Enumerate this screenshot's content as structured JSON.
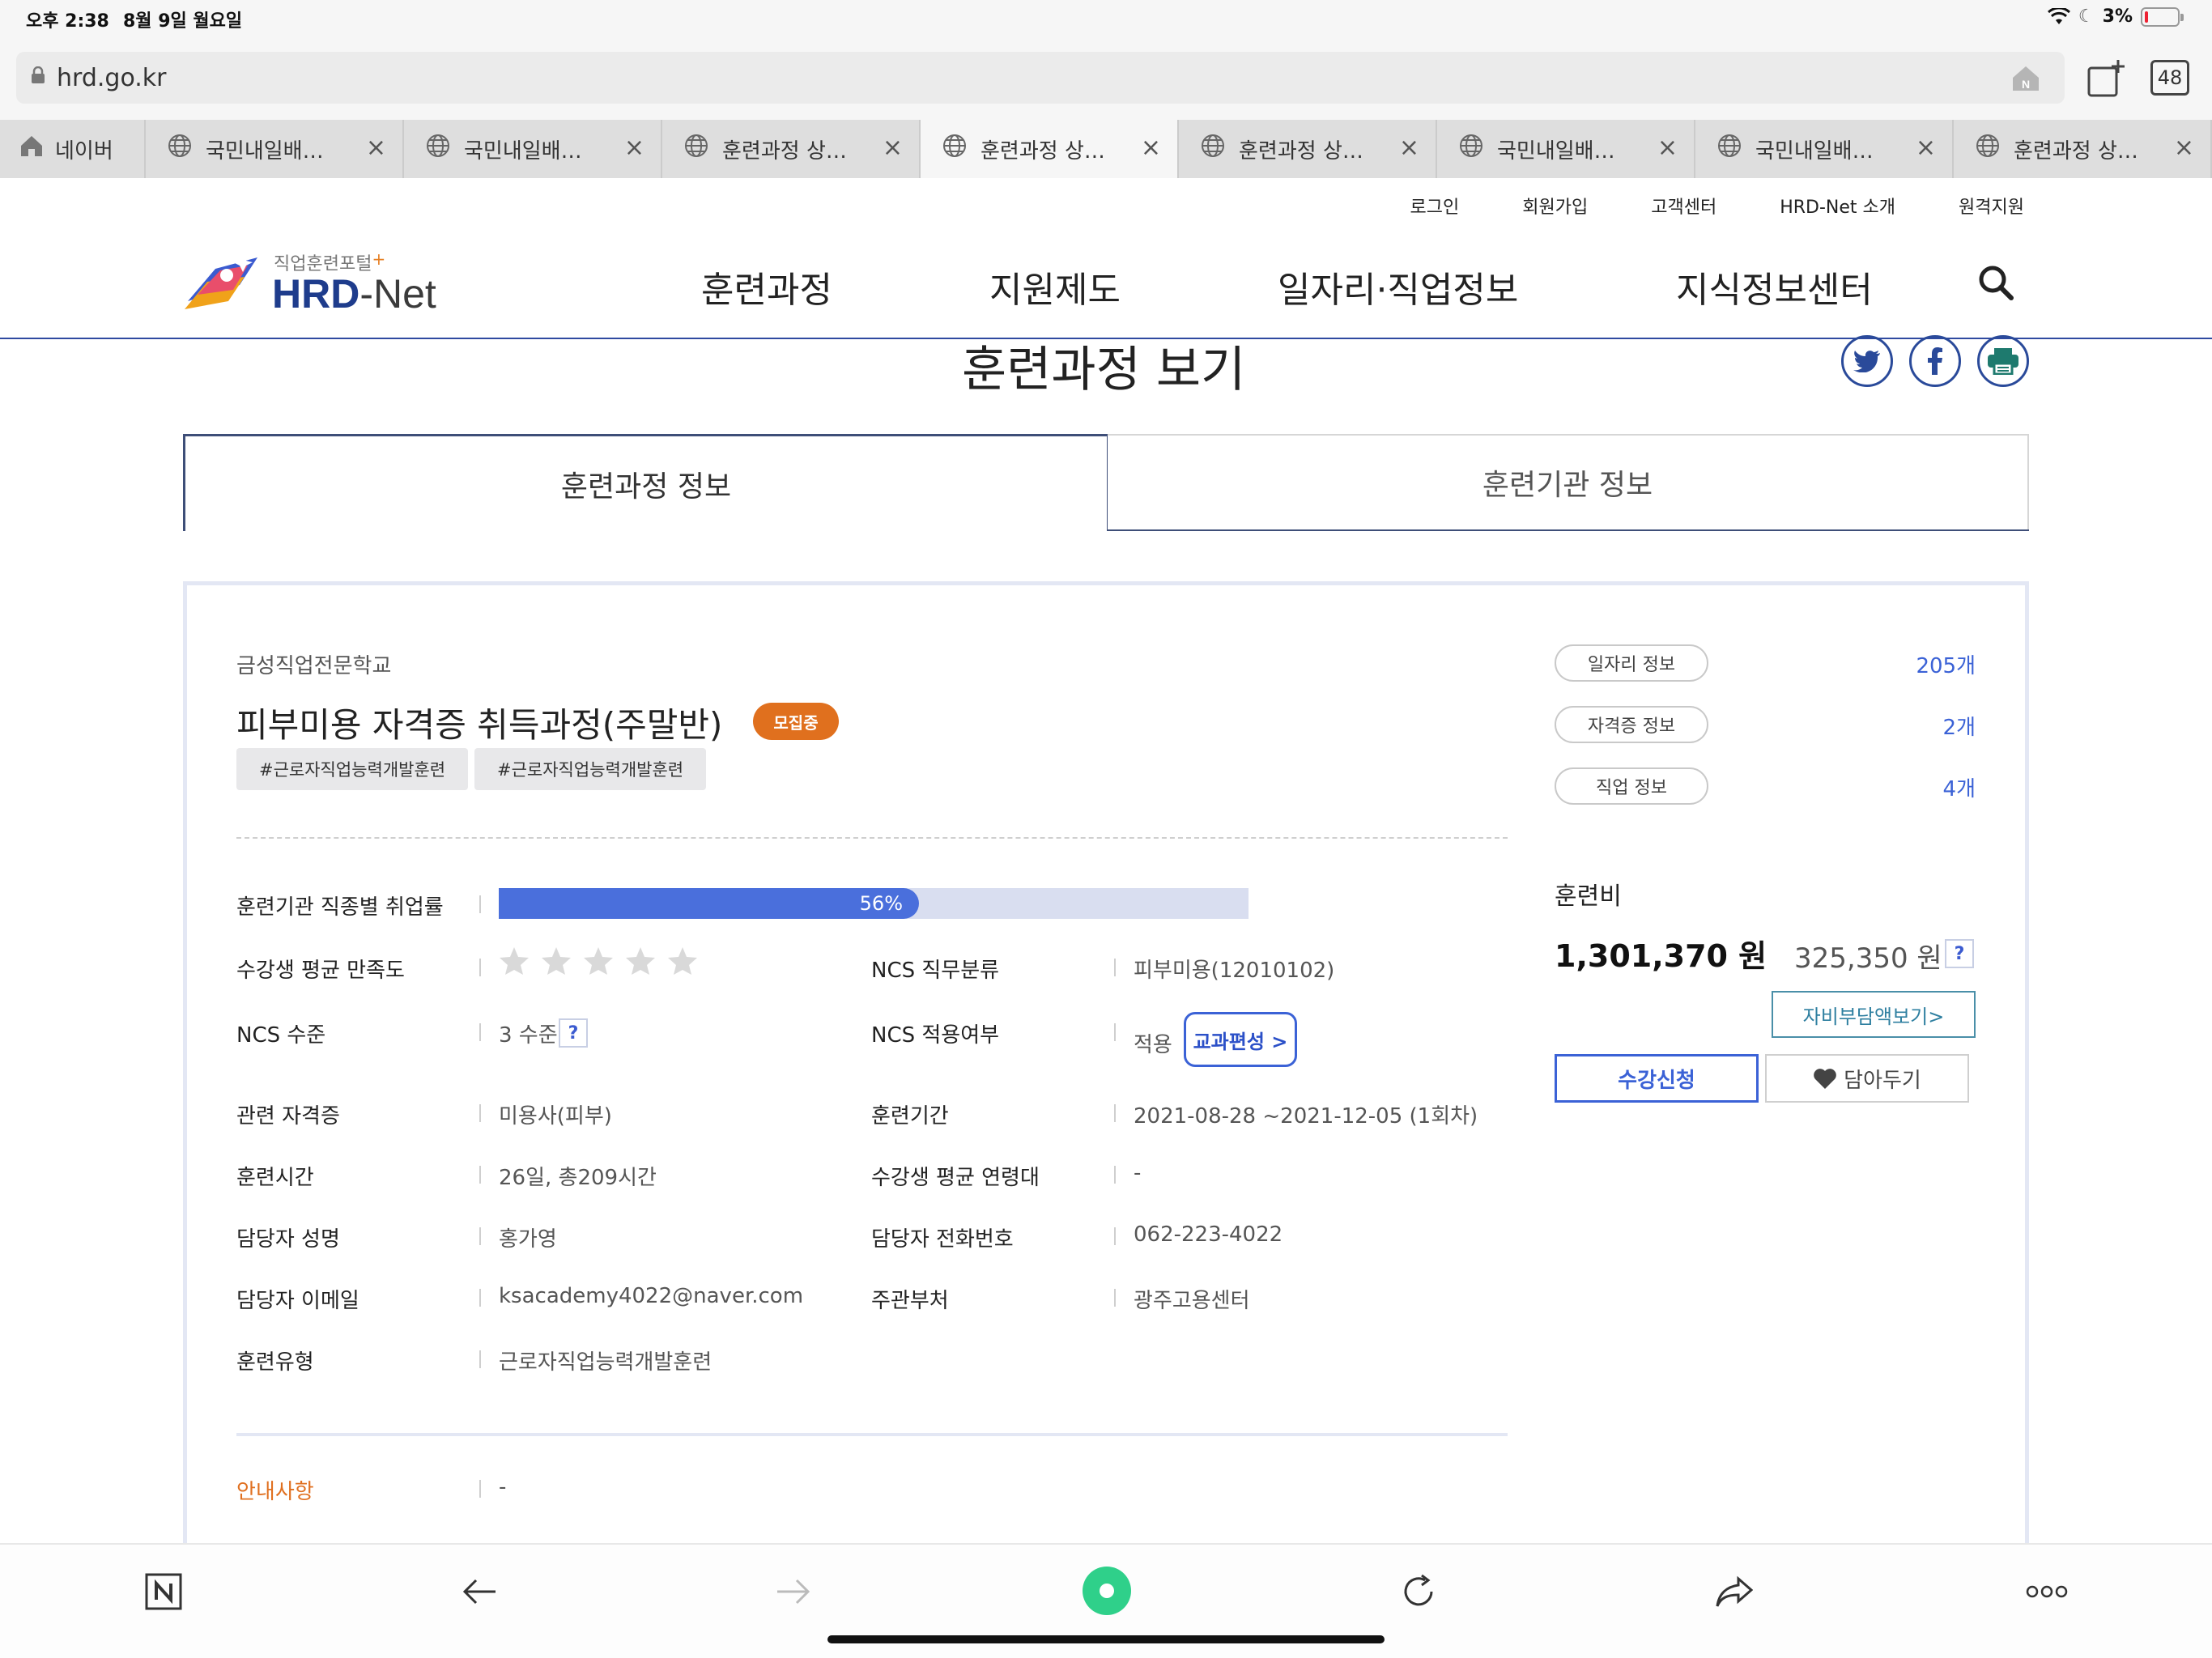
{
  "status_bar": {
    "time": "오후 2:38",
    "date": "8월 9일 월요일",
    "battery": "3%"
  },
  "browser": {
    "url": "hrd.go.kr",
    "tab_count": "48",
    "tabs": [
      {
        "label": "네이버",
        "icon": "home-icon"
      },
      {
        "label": "국민내일배…",
        "icon": "globe-icon"
      },
      {
        "label": "국민내일배…",
        "icon": "globe-icon"
      },
      {
        "label": "훈련과정 상…",
        "icon": "globe-icon"
      },
      {
        "label": "훈련과정 상…",
        "icon": "globe-icon"
      },
      {
        "label": "훈련과정 상…",
        "icon": "globe-icon"
      },
      {
        "label": "국민내일배…",
        "icon": "globe-icon"
      },
      {
        "label": "국민내일배…",
        "icon": "globe-icon"
      },
      {
        "label": "훈련과정 상…",
        "icon": "globe-icon"
      }
    ]
  },
  "site": {
    "logo_sub": "직업훈련포털",
    "logo_main": "HRD",
    "logo_dash": "-",
    "logo_net": "Net",
    "util_nav": [
      "로그인",
      "회원가입",
      "고객센터",
      "HRD-Net 소개",
      "원격지원"
    ],
    "main_nav": [
      "훈련과정",
      "지원제도",
      "일자리·직업정보",
      "지식정보센터"
    ]
  },
  "page": {
    "title": "훈련과정 보기",
    "tabs": [
      "훈련과정 정보",
      "훈련기관 정보"
    ]
  },
  "course": {
    "institution": "금성직업전문학교",
    "title": "피부미용 자격증 취득과정(주말반)",
    "status_badge": "모집중",
    "hashtags": [
      "#근로자직업능력개발훈련",
      "#근로자직업능력개발훈련"
    ],
    "employment_rate_label": "훈련기관 직종별 취업률",
    "employment_rate": 0.56,
    "employment_rate_text": "56%",
    "satisfaction_label": "수강생 평균 만족도",
    "satisfaction_stars": 0,
    "fields": {
      "ncs_job_label": "NCS 직무분류",
      "ncs_job": "피부미용(12010102)",
      "ncs_level_label": "NCS 수준",
      "ncs_level": "3 수준",
      "ncs_apply_label": "NCS 적용여부",
      "ncs_apply": "적용",
      "curriculum_btn": "교과편성 >",
      "cert_label": "관련 자격증",
      "cert": "미용사(피부)",
      "period_label": "훈련기간",
      "period": "2021-08-28 ~2021-12-05 (1회차)",
      "hours_label": "훈련시간",
      "hours": "26일, 총209시간",
      "age_label": "수강생 평균 연령대",
      "age": "-",
      "manager_label": "담당자 성명",
      "manager": "홍가영",
      "phone_label": "담당자 전화번호",
      "phone": "062-223-4022",
      "email_label": "담당자 이메일",
      "email": "ksacademy4022@naver.com",
      "agency_label": "주관부처",
      "agency": "광주고용센터",
      "type_label": "훈련유형",
      "type": "근로자직업능력개발훈련"
    },
    "notice_label": "안내사항",
    "notice": "-"
  },
  "side": {
    "links": [
      {
        "label": "일자리 정보",
        "count": "205개"
      },
      {
        "label": "자격증 정보",
        "count": "2개"
      },
      {
        "label": "직업 정보",
        "count": "4개"
      }
    ],
    "fee_label": "훈련비",
    "fee_total": "1,301,370 원",
    "fee_self": "325,350 원",
    "help": "?",
    "selfpay_btn": "자비부담액보기>",
    "apply_btn": "수강신청",
    "fav_btn": "담아두기"
  },
  "colors": {
    "brand_blue": "#2f4aa0",
    "accent_orange": "#e0701e",
    "progress_blue": "#4a6fdc",
    "toolbar_green": "#2fd08a"
  }
}
